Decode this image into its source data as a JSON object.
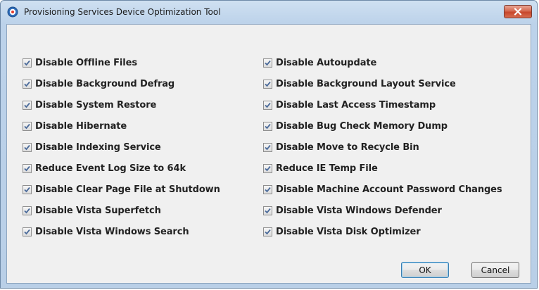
{
  "window": {
    "title": "Provisioning Services Device Optimization Tool"
  },
  "options": {
    "left": [
      {
        "label": "Disable Offline Files",
        "checked": true
      },
      {
        "label": "Disable Background Defrag",
        "checked": true
      },
      {
        "label": "Disable System Restore",
        "checked": true
      },
      {
        "label": "Disable Hibernate",
        "checked": true
      },
      {
        "label": "Disable Indexing Service",
        "checked": true
      },
      {
        "label": "Reduce Event Log Size to 64k",
        "checked": true
      },
      {
        "label": "Disable Clear Page File at Shutdown",
        "checked": true
      },
      {
        "label": "Disable Vista Superfetch",
        "checked": true
      },
      {
        "label": "Disable Vista Windows Search",
        "checked": true
      }
    ],
    "right": [
      {
        "label": "Disable Autoupdate",
        "checked": true
      },
      {
        "label": "Disable Background Layout Service",
        "checked": true
      },
      {
        "label": "Disable Last Access Timestamp",
        "checked": true
      },
      {
        "label": "Disable Bug Check Memory Dump",
        "checked": true
      },
      {
        "label": "Disable Move to Recycle Bin",
        "checked": true
      },
      {
        "label": "Reduce IE Temp File",
        "checked": true
      },
      {
        "label": "Disable Machine Account Password Changes",
        "checked": true
      },
      {
        "label": "Disable Vista Windows Defender",
        "checked": true
      },
      {
        "label": "Disable Vista Disk Optimizer",
        "checked": true
      }
    ]
  },
  "buttons": {
    "ok_label": "OK",
    "cancel_label": "Cancel"
  },
  "icons": {
    "app": "app-icon",
    "close": "close-icon",
    "check": "checkmark-icon"
  },
  "colors": {
    "title_bar": "#bcd2ea",
    "client_bg": "#f0f0f0",
    "close_button": "#c7462b",
    "check_mark": "#4a6a9a"
  }
}
